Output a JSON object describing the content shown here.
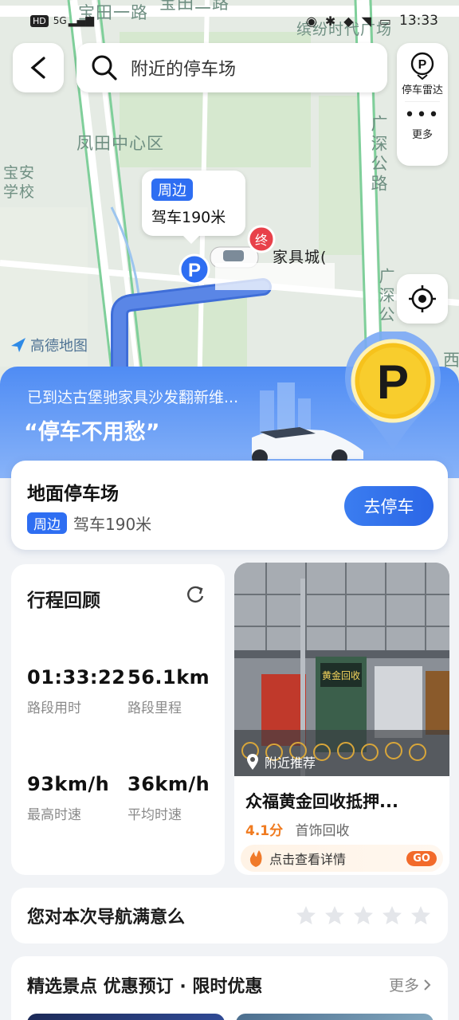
{
  "status_bar": {
    "network": "5G",
    "time": "13:33"
  },
  "map": {
    "labels": {
      "road_top": "宝田一路",
      "road_top2": "宝田二路",
      "district": "凤田中心区",
      "school_line1": "宝安",
      "school_line2": "学校",
      "highway1": "广深公路",
      "highway2": "广深公",
      "west": "西",
      "poi_top": "缤纷时代广场",
      "dest_poi": "家具城("
    },
    "end_marker": "终",
    "parking_marker": "P",
    "logo": "高德地图"
  },
  "search": {
    "placeholder": "附近的停车场"
  },
  "side_panel": {
    "parking_radar": "停车雷达",
    "more": "更多"
  },
  "callout": {
    "tag": "周边",
    "distance": "驾车190米"
  },
  "banner": {
    "arrived_text": "已到达古堡驰家具沙发翻新维...",
    "slogan": "“停车不用愁”",
    "badge": "P"
  },
  "parking_card": {
    "title": "地面停车场",
    "tag": "周边",
    "distance": "驾车190米",
    "button": "去停车"
  },
  "trip_review": {
    "title": "行程回顾",
    "stats": [
      {
        "value": "01:33:22",
        "label": "路段用时"
      },
      {
        "value": "56.1km",
        "label": "路段里程"
      },
      {
        "value": "93km/h",
        "label": "最高时速"
      },
      {
        "value": "36km/h",
        "label": "平均时速"
      }
    ]
  },
  "recommendation": {
    "badge": "附近推荐",
    "name": "众福黄金回收抵押...",
    "score": "4.1分",
    "category": "首饰回收",
    "detail": "点击查看详情",
    "go": "GO",
    "shop_sign": "黄金回收"
  },
  "satisfaction": {
    "question": "您对本次导航满意么",
    "rating": 0,
    "max": 5
  },
  "featured": {
    "title": "精选景点 优惠预订 · 限时优惠",
    "more": "更多"
  },
  "colors": {
    "accent": "#2e6ef2",
    "route": "#3f6ed8",
    "end_marker": "#e8414a",
    "score": "#f07b20"
  }
}
